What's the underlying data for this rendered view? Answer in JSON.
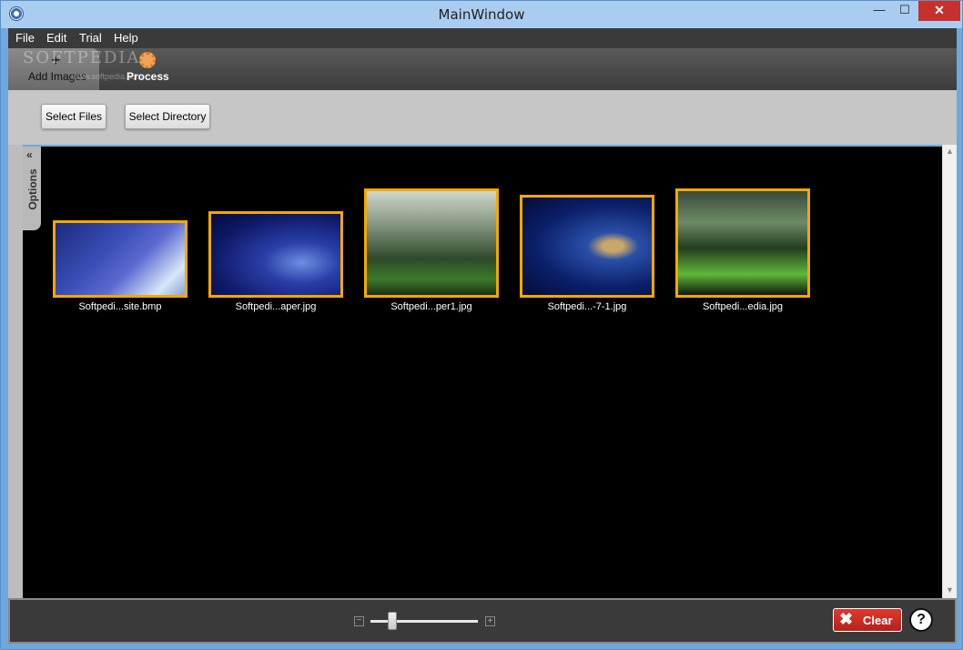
{
  "window": {
    "title": "MainWindow",
    "minimize": "—",
    "maximize": "☐",
    "close": "✕"
  },
  "menu": {
    "items": [
      "File",
      "Edit",
      "Trial",
      "Help"
    ]
  },
  "tabs": {
    "add_images": {
      "icon": "+",
      "label": "Add Images"
    },
    "process": {
      "label": "Process"
    },
    "watermark": "SOFTPEDIA",
    "watermark_sub": "www.softpedia.com"
  },
  "toolbar": {
    "select_files": "Select Files",
    "select_directory": "Select Directory"
  },
  "options": {
    "chevron": "«",
    "label": "Options"
  },
  "images": [
    {
      "label": "Softpedi...site.bmp"
    },
    {
      "label": "Softpedi...aper.jpg"
    },
    {
      "label": "Softpedi...per1.jpg"
    },
    {
      "label": "Softpedi...-7-1.jpg"
    },
    {
      "label": "Softpedi...edia.jpg"
    }
  ],
  "zoom": {
    "minus": "−",
    "plus": "+",
    "level": 0.2
  },
  "footer": {
    "clear_icon": "✖",
    "clear_label": "Clear",
    "help": "?"
  },
  "colors": {
    "accent": "#f5a800",
    "clear_red": "#c62a20",
    "canvas": "#000000"
  }
}
